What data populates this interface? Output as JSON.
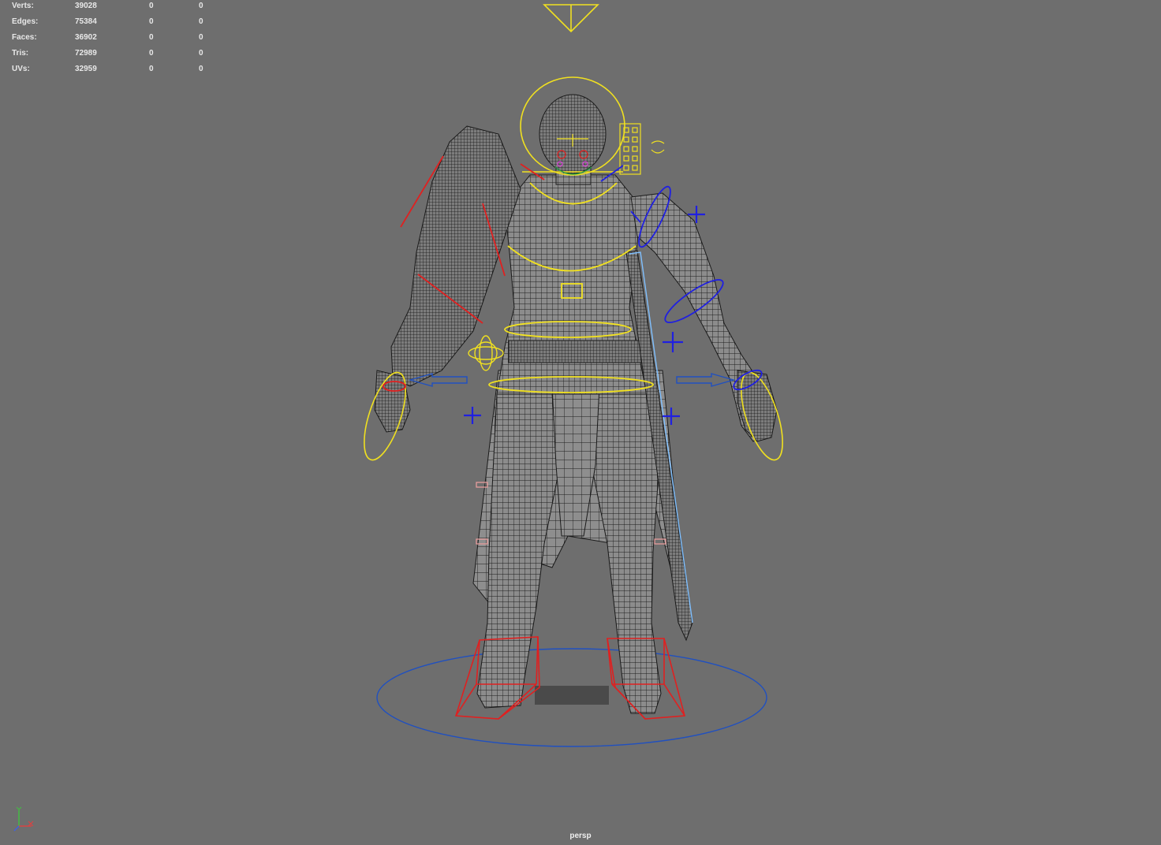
{
  "hud": {
    "rows": [
      {
        "label": "Verts:",
        "total": "39028",
        "selected": "0",
        "extra": "0"
      },
      {
        "label": "Edges:",
        "total": "75384",
        "selected": "0",
        "extra": "0"
      },
      {
        "label": "Faces:",
        "total": "36902",
        "selected": "0",
        "extra": "0"
      },
      {
        "label": "Tris:",
        "total": "72989",
        "selected": "0",
        "extra": "0"
      },
      {
        "label": "UVs:",
        "total": "32959",
        "selected": "0",
        "extra": "0"
      }
    ]
  },
  "viewport": {
    "camera": "persp",
    "background_color": "#6e6e6e"
  },
  "colors": {
    "mesh_wire": "#1a1a1a",
    "mesh_fill": "#8a8a8a",
    "control_yellow": "#f0e020",
    "control_blue": "#2020e0",
    "control_red": "#e02020",
    "control_lightblue": "#80c0ff",
    "ground_circle": "#2050c0"
  },
  "icons": {
    "axis": "xyz-axis-icon",
    "controls": [
      "root-circle-icon",
      "ik-foot-box-icon",
      "fk-arm-circle-icon",
      "head-circle-icon"
    ]
  }
}
